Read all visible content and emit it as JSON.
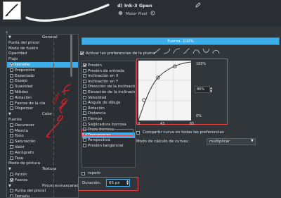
{
  "header": {
    "brush_name": "d) Ink-3 Gpen",
    "engine_label": "Motor Pixel"
  },
  "left_list": {
    "items": [
      {
        "label": "General",
        "type": "header"
      },
      {
        "label": "Punta del pincel",
        "type": "plain"
      },
      {
        "label": "Modo de fusión",
        "type": "plain"
      },
      {
        "label": "Opacidad",
        "type": "plain"
      },
      {
        "label": "Flujo",
        "type": "plain"
      },
      {
        "label": "Tamaño",
        "type": "check",
        "checked": true,
        "selected": true
      },
      {
        "label": "Proporción",
        "type": "check",
        "checked": false
      },
      {
        "label": "Espaciado",
        "type": "check",
        "checked": false
      },
      {
        "label": "Espejo",
        "type": "check",
        "checked": false
      },
      {
        "label": "Suavidad",
        "type": "check",
        "checked": false
      },
      {
        "label": "Nitidez",
        "type": "check",
        "checked": false
      },
      {
        "label": "Rotación",
        "type": "check",
        "checked": false
      },
      {
        "label": "Fuerza de la cla",
        "type": "check",
        "checked": false
      },
      {
        "label": "Dispersar",
        "type": "check",
        "checked": false
      },
      {
        "label": "Color",
        "type": "header"
      },
      {
        "label": "Fuente",
        "type": "plain"
      },
      {
        "label": "Oscurecer",
        "type": "check",
        "checked": false
      },
      {
        "label": "Mezcla",
        "type": "check",
        "checked": false
      },
      {
        "label": "Tono",
        "type": "check",
        "checked": false
      },
      {
        "label": "Saturación",
        "type": "check",
        "checked": false
      },
      {
        "label": "Valor",
        "type": "check",
        "checked": false
      },
      {
        "label": "Aerógrafo",
        "type": "check",
        "checked": false
      },
      {
        "label": "Tasa",
        "type": "check",
        "checked": false
      },
      {
        "label": "Modo de pintura",
        "type": "plain"
      },
      {
        "label": "Textura",
        "type": "header"
      },
      {
        "label": "Patrón",
        "type": "check",
        "checked": false
      },
      {
        "label": "Fuerza",
        "type": "check",
        "checked": true
      },
      {
        "label": "Pincel enmascarado",
        "type": "header"
      },
      {
        "label": "Punta del pincel",
        "type": "check",
        "checked": false
      },
      {
        "label": "Tamaño",
        "type": "check",
        "checked": false
      }
    ]
  },
  "fuerza_label": "Fuerza: 100%",
  "activate_label": "Activar las preferencias de la pluma",
  "curve_presets": [
    "linear",
    "ease-in",
    "ease-out",
    "s-curve",
    "bump-up",
    "bump-down",
    "arch"
  ],
  "sensors": [
    {
      "label": "Presión",
      "checked": true
    },
    {
      "label": "Presión de entrada",
      "checked": false
    },
    {
      "label": "Inclinación en X",
      "checked": false
    },
    {
      "label": "Inclinación en Y",
      "checked": false
    },
    {
      "label": "Dirección de la inclinación",
      "checked": false
    },
    {
      "label": "Elevación de la inclinación",
      "checked": false
    },
    {
      "label": "Velocidad",
      "checked": false
    },
    {
      "label": "Ángulo de dibujo",
      "checked": false
    },
    {
      "label": "Rotación",
      "checked": false
    },
    {
      "label": "Distancia",
      "checked": false
    },
    {
      "label": "Tiempo",
      "checked": false
    },
    {
      "label": "Salpicadura borrosa",
      "checked": false
    },
    {
      "label": "Traza borrosa",
      "checked": false
    },
    {
      "label": "Desvanecer",
      "checked": true,
      "selected": true
    },
    {
      "label": "Perspectiva",
      "checked": false
    },
    {
      "label": "Presión tangencial",
      "checked": false
    }
  ],
  "curve": {
    "y_max_label": "100%",
    "y_min_label": "0%",
    "point_value": "86%",
    "x_ticks": [
      "0",
      "43",
      "65"
    ]
  },
  "share_label": "Compartir curva en todas las preferencias",
  "calc_mode_label": "Modo de cálculo de curvas:",
  "calc_mode_value": "multiplicar",
  "repeat_label": "repetir",
  "duration_label": "Duración:",
  "duration_value": "65 px",
  "annotation_text": "Fade",
  "colors": {
    "accent": "#3daee9",
    "highlight": "#e8454b",
    "bg": "#31363b"
  }
}
